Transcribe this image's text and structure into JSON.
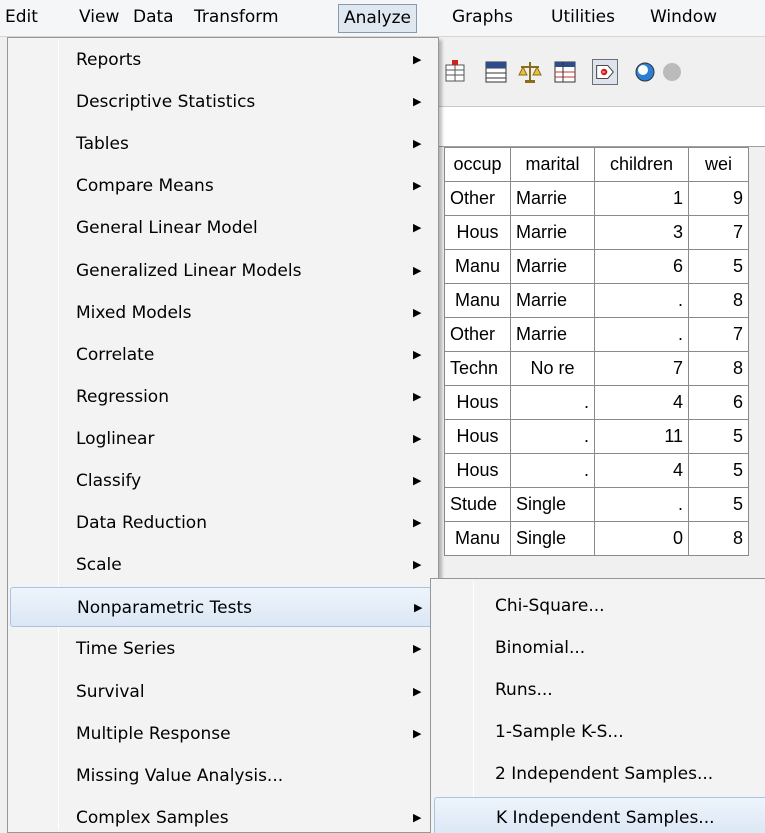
{
  "menubar": {
    "items": [
      {
        "label": "Edit"
      },
      {
        "label": "View"
      },
      {
        "label": "Data"
      },
      {
        "label": "Transform"
      },
      {
        "label": "Analyze"
      },
      {
        "label": "Graphs"
      },
      {
        "label": "Utilities"
      },
      {
        "label": "Window"
      }
    ],
    "active": "Analyze"
  },
  "toolbar": {
    "icons": [
      "insert-cases-icon",
      "split-file-icon",
      "weight-cases-icon",
      "select-cases-icon",
      "value-labels-icon",
      "use-sets-icon",
      "show-all-icon"
    ]
  },
  "grid": {
    "columns": [
      "occup",
      "marital",
      "children",
      "wei"
    ],
    "rows": [
      [
        "Other",
        "Marrie",
        "1",
        "9"
      ],
      [
        "Hous",
        "Marrie",
        "3",
        "7"
      ],
      [
        "Manu",
        "Marrie",
        "6",
        "5"
      ],
      [
        "Manu",
        "Marrie",
        ".",
        "8"
      ],
      [
        "Other",
        "Marrie",
        ".",
        "7"
      ],
      [
        "Techn",
        "No re",
        "7",
        "8"
      ],
      [
        "Hous",
        ".",
        "4",
        "6"
      ],
      [
        "Hous",
        ".",
        "11",
        "5"
      ],
      [
        "Hous",
        ".",
        "4",
        "5"
      ],
      [
        "Stude",
        "Single",
        ".",
        "5"
      ],
      [
        "Manu",
        "Single",
        "0",
        "8"
      ]
    ]
  },
  "analyze_menu": {
    "items": [
      {
        "label": "Reports",
        "submenu": true
      },
      {
        "label": "Descriptive Statistics",
        "submenu": true
      },
      {
        "label": "Tables",
        "submenu": true
      },
      {
        "label": "Compare Means",
        "submenu": true
      },
      {
        "label": "General Linear Model",
        "submenu": true
      },
      {
        "label": "Generalized Linear Models",
        "submenu": true
      },
      {
        "label": "Mixed Models",
        "submenu": true
      },
      {
        "label": "Correlate",
        "submenu": true
      },
      {
        "label": "Regression",
        "submenu": true
      },
      {
        "label": "Loglinear",
        "submenu": true
      },
      {
        "label": "Classify",
        "submenu": true
      },
      {
        "label": "Data Reduction",
        "submenu": true
      },
      {
        "label": "Scale",
        "submenu": true
      },
      {
        "label": "Nonparametric Tests",
        "submenu": true,
        "highlighted": true
      },
      {
        "label": "Time Series",
        "submenu": true
      },
      {
        "label": "Survival",
        "submenu": true
      },
      {
        "label": "Multiple Response",
        "submenu": true
      },
      {
        "label": "Missing Value Analysis...",
        "submenu": false
      },
      {
        "label": "Complex Samples",
        "submenu": true
      }
    ]
  },
  "nonparametric_menu": {
    "items": [
      {
        "label": "Chi-Square..."
      },
      {
        "label": "Binomial..."
      },
      {
        "label": "Runs..."
      },
      {
        "label": "1-Sample K-S..."
      },
      {
        "label": "2 Independent Samples..."
      },
      {
        "label": "K Independent Samples...",
        "highlighted": true
      }
    ]
  },
  "glyphs": {
    "submenu_arrow": "▶"
  }
}
